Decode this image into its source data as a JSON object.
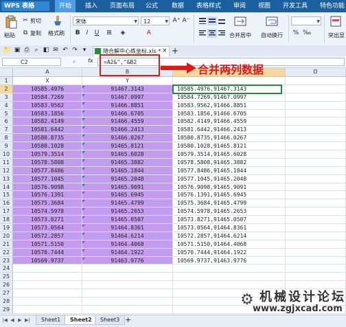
{
  "app": {
    "name": "WPS 表格"
  },
  "menu": [
    "开始",
    "插入",
    "页面布局",
    "公式",
    "数据",
    "表格样式",
    "审阅",
    "视图",
    "开发工具",
    "特色功能"
  ],
  "ribbon": {
    "paste": "粘贴",
    "cut": "剪切",
    "copy": "复制",
    "format_painter": "格式刷",
    "font_name": "宋体",
    "font_size": "12",
    "grow_font": "A⁺",
    "shrink_font": "A⁻",
    "bold": "B",
    "italic": "I",
    "underline": "U",
    "merge_center": "合并居中",
    "wrap_text": "自动换行",
    "percent": "%",
    "highlight_dup": "突出显"
  },
  "document_tab": {
    "name": "随合解中心练坐标.xls *"
  },
  "formula_bar": {
    "cell_ref": "C2",
    "fx": "fx",
    "formula": "=A2&\",\"&B2"
  },
  "annotation": {
    "text": "合并两列数据"
  },
  "columns": [
    "A",
    "B",
    "C",
    "D"
  ],
  "rows": [
    {
      "n": "1",
      "a": "X",
      "b": "Y",
      "c": ""
    },
    {
      "n": "2",
      "a": "10585.4976",
      "b": "91467.3143",
      "c": "10585.4976,91467.3143"
    },
    {
      "n": "3",
      "a": "10584.7269",
      "b": "91467.0997",
      "c": "10584.7269,91467.0997"
    },
    {
      "n": "4",
      "a": "10583.9562",
      "b": "91466.8851",
      "c": "10583.9562,91466.8851"
    },
    {
      "n": "5",
      "a": "10583.1856",
      "b": "91466.6705",
      "c": "10583.1856,91466.6705"
    },
    {
      "n": "6",
      "a": "10582.4149",
      "b": "91466.4559",
      "c": "10582.4149,91466.4559"
    },
    {
      "n": "7",
      "a": "10581.6442",
      "b": "91466.2413",
      "c": "10581.6442,91466.2413"
    },
    {
      "n": "8",
      "a": "10580.8735",
      "b": "91466.0267",
      "c": "10580.8735,91466.0267"
    },
    {
      "n": "9",
      "a": "10580.1028",
      "b": "91465.8121",
      "c": "10580.1028,91465.8121"
    },
    {
      "n": "10",
      "a": "10579.3514",
      "b": "91465.6028",
      "c": "10579.3514,91465.6028"
    },
    {
      "n": "11",
      "a": "10578.5808",
      "b": "91465.3882",
      "c": "10578.5808,91465.3882"
    },
    {
      "n": "12",
      "a": "10577.8486",
      "b": "91465.1844",
      "c": "10577.8486,91465.1844"
    },
    {
      "n": "13",
      "a": "10577.1045",
      "b": "91465.2048",
      "c": "10577.1045,91465.2048"
    },
    {
      "n": "14",
      "a": "10576.9098",
      "b": "91465.9091",
      "c": "10576.9098,91465.9091"
    },
    {
      "n": "15",
      "a": "10576.1391",
      "b": "91465.6945",
      "c": "10576.1391,91465.6945"
    },
    {
      "n": "16",
      "a": "10575.3684",
      "b": "91465.4799",
      "c": "10575.3684,91465.4799"
    },
    {
      "n": "17",
      "a": "10574.5978",
      "b": "91465.2653",
      "c": "10574.5978,91465.2653"
    },
    {
      "n": "18",
      "a": "10573.8271",
      "b": "91465.0507",
      "c": "10573.8271,91465.0507"
    },
    {
      "n": "19",
      "a": "10573.0564",
      "b": "91464.8361",
      "c": "10573.0564,91464.8361"
    },
    {
      "n": "20",
      "a": "10572.2857",
      "b": "91464.6214",
      "c": "10572.2857,91464.6214"
    },
    {
      "n": "21",
      "a": "10571.5150",
      "b": "91464.4068",
      "c": "10571.5150,91464.4068"
    },
    {
      "n": "22",
      "a": "10570.7444",
      "b": "91464.1922",
      "c": "10570.7444,91464.1922"
    },
    {
      "n": "23",
      "a": "10569.9737",
      "b": "91463.9776",
      "c": "10569.9737,91463.9776"
    },
    {
      "n": "24",
      "a": "",
      "b": "",
      "c": ""
    },
    {
      "n": "25",
      "a": "",
      "b": "",
      "c": ""
    },
    {
      "n": "26",
      "a": "",
      "b": "",
      "c": ""
    },
    {
      "n": "27",
      "a": "",
      "b": "",
      "c": ""
    },
    {
      "n": "28",
      "a": "",
      "b": "",
      "c": ""
    },
    {
      "n": "29",
      "a": "",
      "b": "",
      "c": ""
    }
  ],
  "sheets": [
    "Sheet1",
    "Sheet2",
    "Sheet3"
  ],
  "active_sheet": "Sheet2",
  "watermark": {
    "title": "机械设计论坛",
    "url": "www.zgjxcad.com"
  },
  "colors": {
    "selection_fill": "#c39cf0",
    "annotation": "#e01818",
    "menu_bar": "#1a5f9e"
  }
}
